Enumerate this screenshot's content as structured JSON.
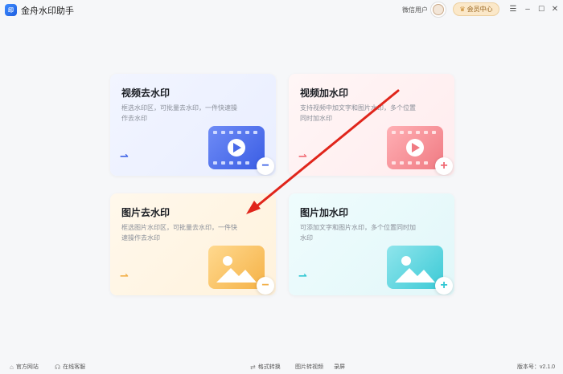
{
  "app": {
    "title": "金舟水印助手",
    "logo_text": "印"
  },
  "header": {
    "user_name": "微信用户",
    "vip_label": "会员中心"
  },
  "window_controls": {
    "menu": "☰",
    "minimize": "–",
    "maximize": "☐",
    "close": "✕"
  },
  "cards": [
    {
      "title": "视频去水印",
      "desc": "框选水印区，可批量去水印，一件快速操作去水印",
      "action": "−"
    },
    {
      "title": "视频加水印",
      "desc": "支持视频中加文字和图片水印，多个位置同时加水印",
      "action": "+"
    },
    {
      "title": "图片去水印",
      "desc": "框选图片水印区，可批量去水印，一件快速操作去水印",
      "action": "−"
    },
    {
      "title": "图片加水印",
      "desc": "可添加文字和图片水印，多个位置同时加水印",
      "action": "+"
    }
  ],
  "footer": {
    "website": "官方网站",
    "support": "在线客服",
    "format_convert": "格式转换",
    "image_to_video": "图片转视频",
    "record": "录屏",
    "version": "版本号：v2.1.0"
  },
  "colors": {
    "video_remove_accent": "#3e63e6",
    "video_add_accent": "#f06a73",
    "image_remove_accent": "#f2b04a",
    "image_add_accent": "#32c7d3",
    "annotation_arrow": "#e0251b"
  }
}
